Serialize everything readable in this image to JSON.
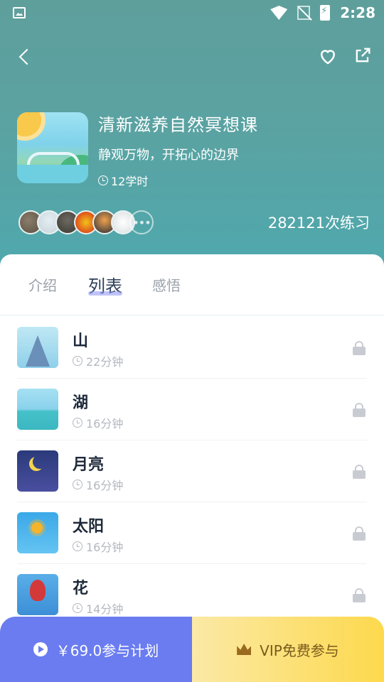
{
  "status_bar": {
    "time": "2:28"
  },
  "course": {
    "title": "清新滋养自然冥想课",
    "subtitle": "静观万物，开拓心的边界",
    "hours": "12学时",
    "practice_count": "282121次练习"
  },
  "tabs": [
    {
      "label": "介绍"
    },
    {
      "label": "列表"
    },
    {
      "label": "感悟"
    }
  ],
  "lessons": [
    {
      "title": "山",
      "duration": "22分钟"
    },
    {
      "title": "湖",
      "duration": "16分钟"
    },
    {
      "title": "月亮",
      "duration": "16分钟"
    },
    {
      "title": "太阳",
      "duration": "16分钟"
    },
    {
      "title": "花",
      "duration": "14分钟"
    }
  ],
  "bottom": {
    "join_label": "￥69.0参与计划",
    "vip_label": "VIP免费参与"
  },
  "colors": {
    "hero": "#5aa3a3",
    "join_button": "#6a7cf0",
    "vip_button": "#fdd94d",
    "tab_active": "#2c3e5a"
  },
  "icons": [
    "back-icon",
    "heart-icon",
    "share-icon",
    "clock-icon",
    "lock-icon",
    "play-icon",
    "crown-icon"
  ]
}
